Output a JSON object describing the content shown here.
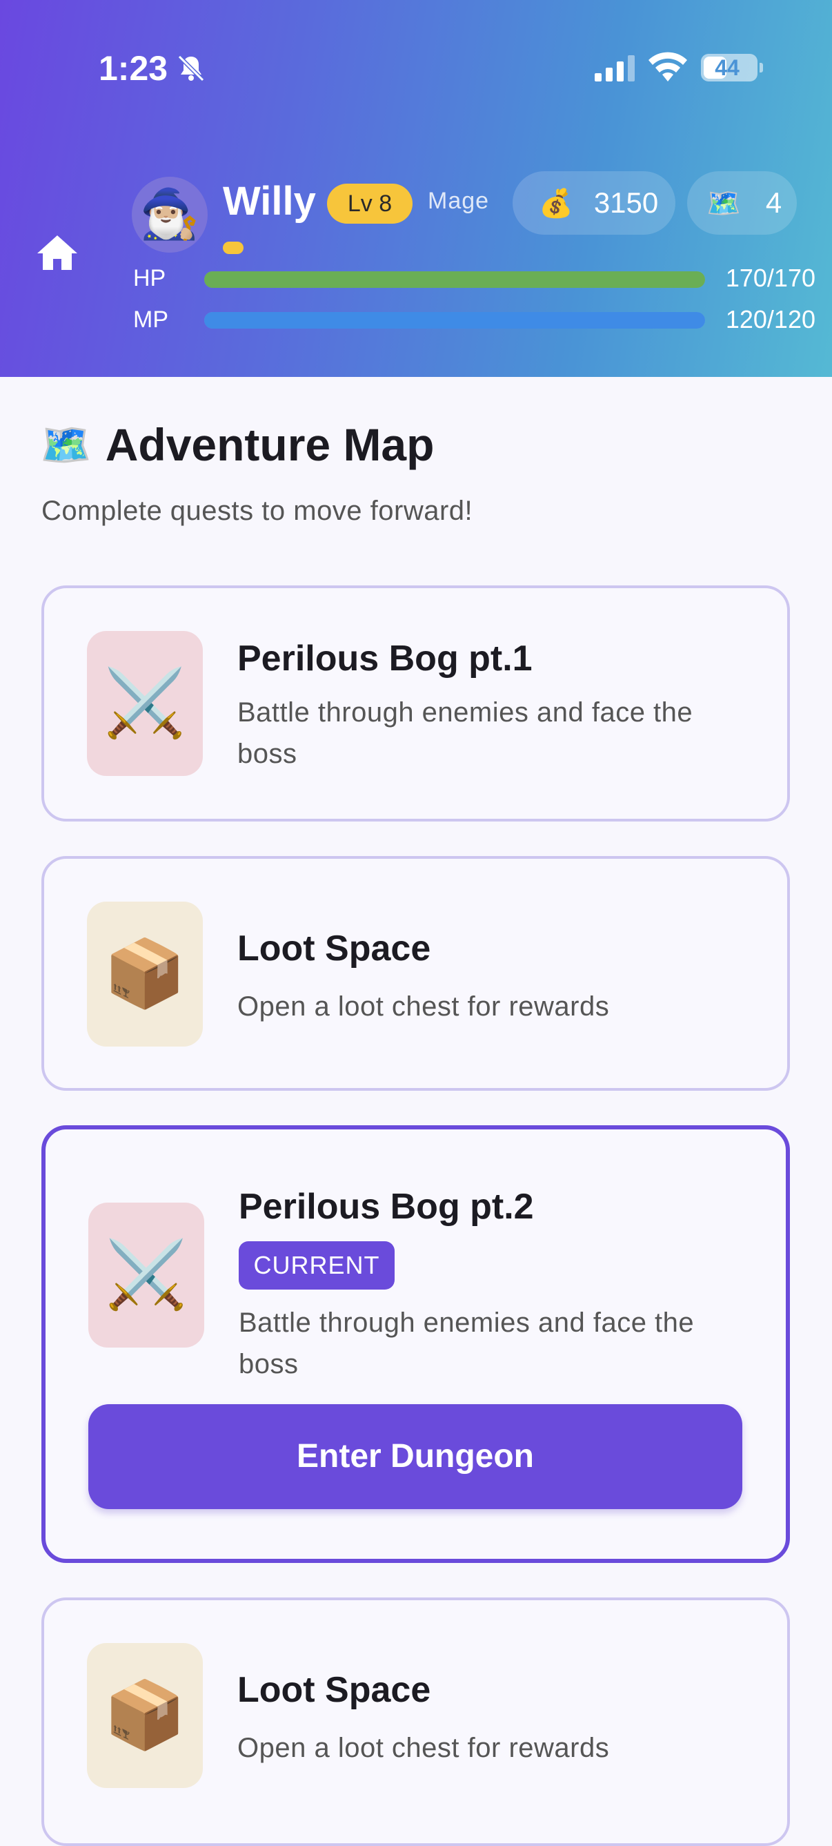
{
  "status_bar": {
    "time": "1:23",
    "battery": "44",
    "battery_level": 0.44,
    "icons": [
      "bell-slash-icon",
      "signal-icon",
      "wifi-icon",
      "battery-icon"
    ]
  },
  "header": {
    "home_icon": "home-icon",
    "avatar_emoji": "🧙🏼‍♂️",
    "player_name": "Willy",
    "level": "Lv 8",
    "player_class": "Mage",
    "gold_emoji": "💰",
    "gold": "3150",
    "maps_emoji": "🗺️",
    "maps": "4",
    "xp_fraction": 0.03,
    "hp_label": "HP",
    "hp_value": "170/170",
    "hp_fraction": 1.0,
    "mp_label": "MP",
    "mp_value": "120/120",
    "mp_fraction": 1.0,
    "colors": {
      "level_badge": "#f7c53b",
      "hp_bar": "#6aae55",
      "mp_bar": "#3f8be6"
    }
  },
  "main": {
    "title_emoji": "🗺️",
    "title": "Adventure Map",
    "subtitle": "Complete quests to move forward!",
    "cards": [
      {
        "emoji": "⚔️",
        "title": "Perilous Bog pt.1",
        "description": "Battle through enemies and face the boss"
      },
      {
        "emoji": "📦",
        "title": "Loot Space",
        "description": "Open a loot chest for rewards"
      },
      {
        "emoji": "⚔️",
        "title": "Perilous Bog pt.2",
        "badge": "CURRENT",
        "description": "Battle through enemies and face the boss",
        "button": "Enter Dungeon"
      },
      {
        "emoji": "📦",
        "title": "Loot Space",
        "description": "Open a loot chest for rewards"
      }
    ],
    "accent_color": "#6a4bdb"
  }
}
